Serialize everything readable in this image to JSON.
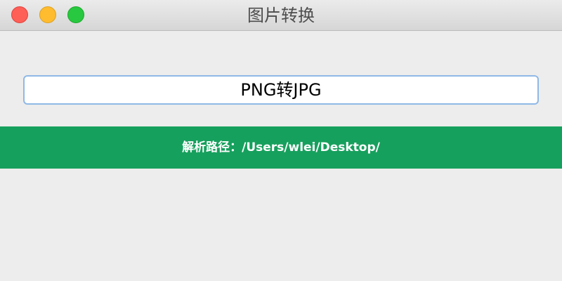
{
  "window": {
    "title": "图片转换"
  },
  "main": {
    "convert_button_label": "PNG转JPG"
  },
  "status": {
    "parse_path_text": "解析路径：/Users/wlei/Desktop/"
  },
  "colors": {
    "status_background": "#16a05d",
    "button_border": "#8fb8e6",
    "window_background": "#ededed"
  },
  "icons": {
    "close": "close-button",
    "minimize": "minimize-button",
    "zoom": "zoom-button"
  }
}
